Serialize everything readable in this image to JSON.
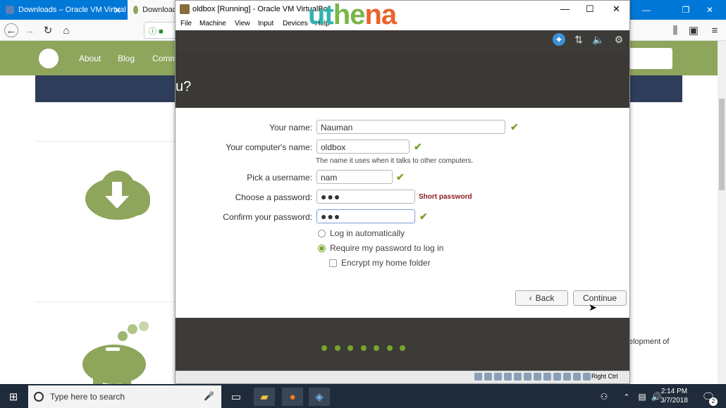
{
  "browser": {
    "tabs": [
      {
        "label": "Downloads – Oracle VM Virtual"
      },
      {
        "label": "Download"
      }
    ]
  },
  "website": {
    "nav": [
      "About",
      "Blog",
      "Commser)"
    ],
    "side_text": "elopment of"
  },
  "vbox": {
    "title": "oldbox [Running] - Oracle VM VirtualBo",
    "menu": [
      "File",
      "Machine",
      "View",
      "Input",
      "Devices",
      "Help"
    ],
    "watermark": "uthena",
    "status_right": "Right Ctrl"
  },
  "installer": {
    "question": "u?",
    "fields": {
      "your_name_label": "Your name:",
      "your_name_value": "Nauman",
      "computer_name_label": "Your computer's name:",
      "computer_name_value": "oldbox",
      "computer_name_hint": "The name it uses when it talks to other computers.",
      "username_label": "Pick a username:",
      "username_value": "nam",
      "password_label": "Choose a password:",
      "password_value": "●●●",
      "password_strength": "Short password",
      "confirm_label": "Confirm your password:",
      "confirm_value": "●●●"
    },
    "options": {
      "auto_login": "Log in automatically",
      "require_password": "Require my password to log in",
      "encrypt_home": "Encrypt my home folder",
      "selected": "require_password",
      "encrypt_checked": false
    },
    "buttons": {
      "back": "Back",
      "continue": "Continue"
    },
    "progress": {
      "total_steps": 7
    },
    "accent": "#7aa32c"
  },
  "taskbar": {
    "search_placeholder": "Type here to search",
    "time": "2:14 PM",
    "date": "3/7/2018",
    "notifications": "2"
  }
}
